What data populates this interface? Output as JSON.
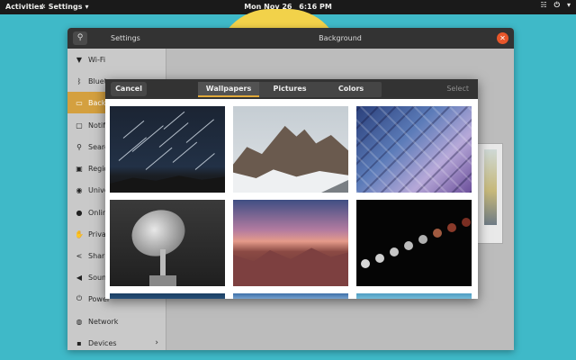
{
  "topbar": {
    "activities": "Activities",
    "app_name": "Settings",
    "date": "Mon Nov 26",
    "time": "6:16 PM"
  },
  "window": {
    "title": "Settings",
    "page_title": "Background"
  },
  "sidebar": {
    "items": [
      {
        "label": "Wi-Fi",
        "icon": "wifi-icon"
      },
      {
        "label": "Blueto",
        "icon": "bluetooth-icon"
      },
      {
        "label": "Backgr",
        "icon": "background-icon",
        "active": true
      },
      {
        "label": "Notific",
        "icon": "notifications-icon"
      },
      {
        "label": "Search",
        "icon": "search-icon"
      },
      {
        "label": "Region",
        "icon": "region-icon"
      },
      {
        "label": "Univers",
        "icon": "universal-access-icon"
      },
      {
        "label": "Online",
        "icon": "online-accounts-icon"
      },
      {
        "label": "Privac",
        "icon": "privacy-icon"
      },
      {
        "label": "Sharin",
        "icon": "sharing-icon"
      },
      {
        "label": "Sound",
        "icon": "sound-icon"
      },
      {
        "label": "Power",
        "icon": "power-icon"
      },
      {
        "label": "Network",
        "icon": "network-icon"
      },
      {
        "label": "Devices",
        "icon": "devices-icon"
      }
    ]
  },
  "dialog": {
    "cancel": "Cancel",
    "select": "Select",
    "tabs": [
      "Wallpapers",
      "Pictures",
      "Colors"
    ],
    "active_tab": "Wallpapers",
    "wallpapers": [
      "star-trails",
      "rocky-mountains",
      "geometric-glass-ceiling",
      "satellite-dish",
      "canyon-dusk",
      "lunar-eclipse-sequence"
    ]
  },
  "colors": {
    "desktop": "#3fb9c8",
    "accent": "#d4a03f",
    "close": "#e8562a"
  }
}
